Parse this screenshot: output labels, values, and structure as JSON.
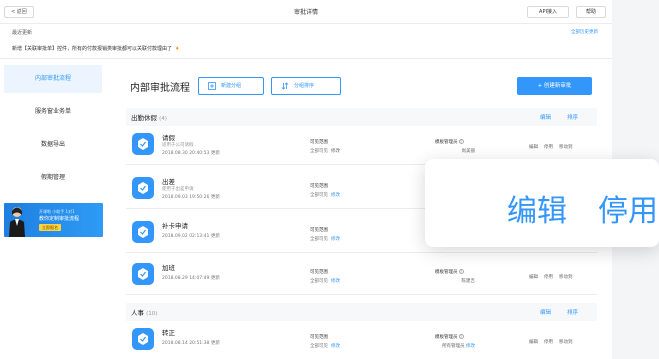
{
  "header": {
    "back_label": "< 返回",
    "title": "审批详情",
    "api_label": "API接入",
    "help_label": "帮助"
  },
  "updates": {
    "title": "最近更新",
    "view_all": "全部历史更新",
    "message": "新增【关联审批单】控件，所有的付款报销类审批都可以关联付款理由了",
    "warn_icon": "fire-icon"
  },
  "sidebar": {
    "items": [
      {
        "label": "内部审批流程",
        "active": true
      },
      {
        "label": "服务窗业务单",
        "active": false
      },
      {
        "label": "数据导出",
        "active": false
      },
      {
        "label": "假期管理",
        "active": false
      }
    ],
    "banner": {
      "line1": "开课啦 小助手 1对1",
      "line2": "教你定制审批流程",
      "tag": "立即报名"
    }
  },
  "main": {
    "title": "内部审批流程",
    "new_group_label": "新建分组",
    "sort_group_label": "分组排序",
    "create_label": "+ 创建新审批",
    "groups": [
      {
        "name": "出勤休假",
        "count": "(4)",
        "edit_label": "编辑",
        "sort_label": "排序",
        "items": [
          {
            "name": "请假",
            "desc": "适用于公司请假",
            "updated": "2018.08.30 20:40:53 更新",
            "scope_title": "可见范围",
            "scope_value": "全部可见",
            "scope_link": "修改",
            "admin_title": "模板管理员",
            "admin_value": "尚美丽",
            "ops": [
              "编辑",
              "停用",
              "移动到"
            ]
          },
          {
            "name": "出差",
            "desc": "使用于出差申请",
            "updated": "2018.09.03 19:50:26 更新",
            "scope_title": "可见范围",
            "scope_value": "全部可见",
            "scope_link": "修改",
            "admin_title": "",
            "admin_value": "",
            "ops": []
          },
          {
            "name": "补卡申请",
            "desc": "",
            "updated": "2018.09.02 02:13:41 更新",
            "scope_title": "可见范围",
            "scope_value": "全部可见",
            "scope_link": "修改",
            "admin_title": "",
            "admin_value": "",
            "ops": []
          },
          {
            "name": "加班",
            "desc": "",
            "updated": "2018.08.29 14:07:49 更新",
            "scope_title": "可见范围",
            "scope_value": "全部可见",
            "scope_link": "修改",
            "admin_title": "模板管理员",
            "admin_value": "陈建吉",
            "ops": [
              "编辑",
              "停用",
              "移动到"
            ]
          }
        ]
      },
      {
        "name": "人事",
        "count": "(10)",
        "edit_label": "编辑",
        "sort_label": "排序",
        "items": [
          {
            "name": "转正",
            "desc": "",
            "updated": "2018.08.14 20:51:38 更新",
            "scope_title": "可见范围",
            "scope_value": "全部可见",
            "scope_link": "修改",
            "admin_title": "模板管理员",
            "admin_value": "所有管理员",
            "admin_link": "修改",
            "ops": [
              "编辑",
              "停用",
              "移动到"
            ]
          }
        ]
      }
    ]
  },
  "popover": {
    "edit_label": "编辑",
    "disable_label": "停用"
  },
  "colors": {
    "accent": "#3296fa",
    "active_bg": "#ecf5ff",
    "group_bg": "#f7f8fa"
  }
}
